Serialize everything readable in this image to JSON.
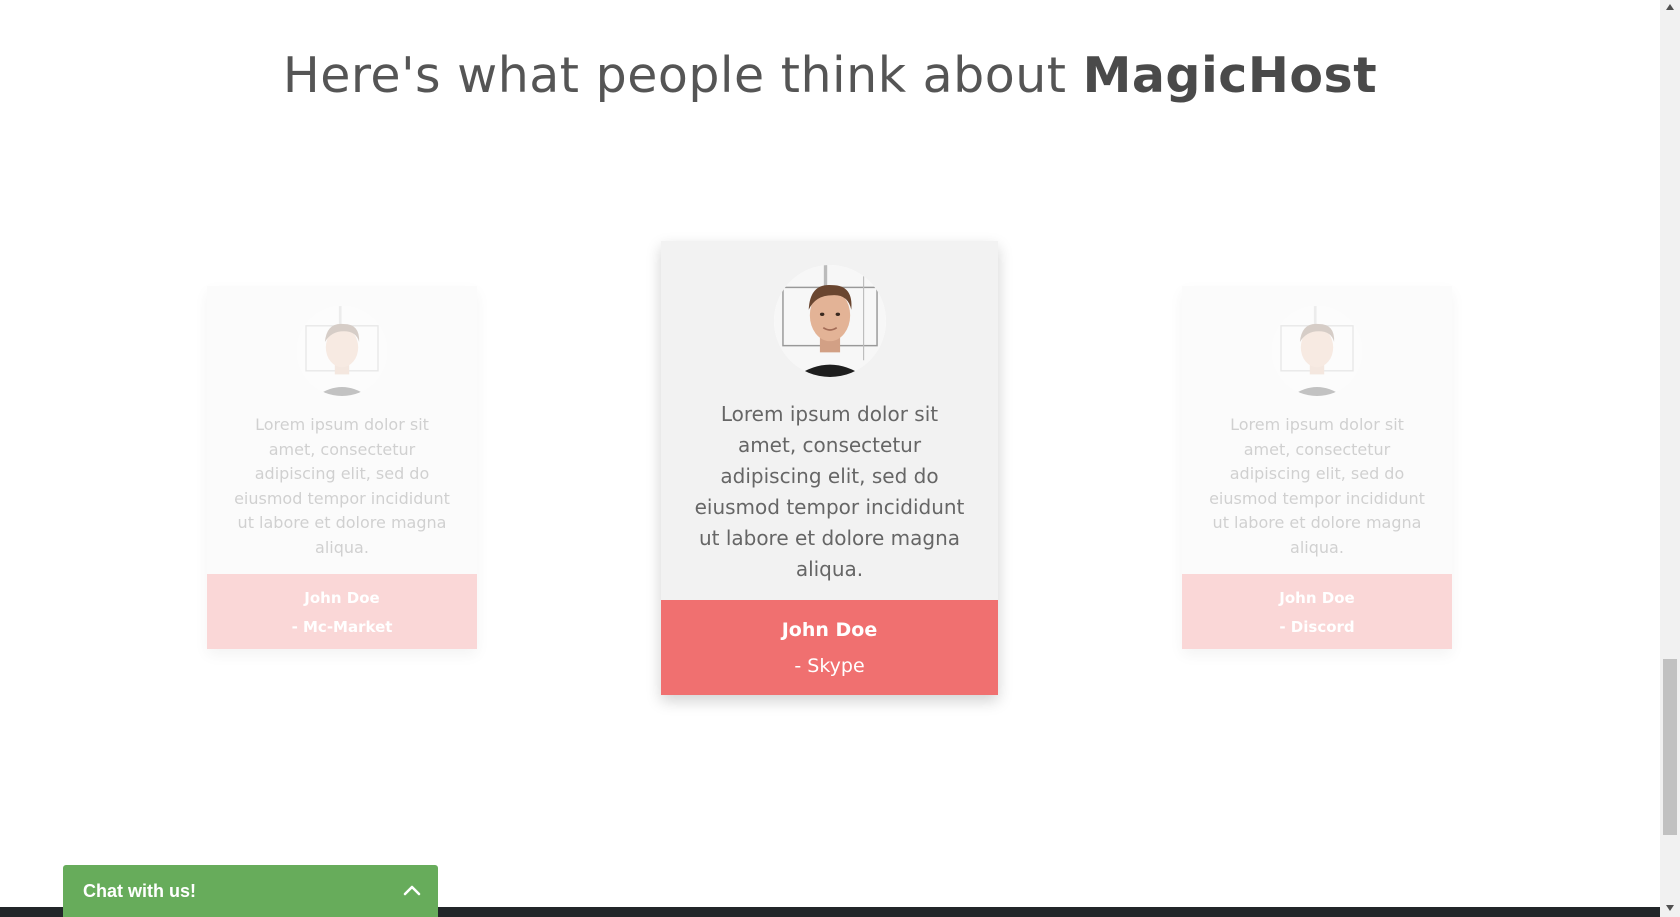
{
  "section": {
    "title_prefix": "Here's what people think about ",
    "title_brand": "MagicHost"
  },
  "testimonials": [
    {
      "quote": "Lorem ipsum dolor sit amet, consectetur adipiscing elit, sed do eiusmod tempor incididunt ut labore et dolore magna aliqua.",
      "name": "John Doe",
      "source": "- Mc-Market",
      "state": "faded"
    },
    {
      "quote": "Lorem ipsum dolor sit amet, consectetur adipiscing elit, sed do eiusmod tempor incididunt ut labore et dolore magna aliqua.",
      "name": "John Doe",
      "source": "- Skype",
      "state": "active"
    },
    {
      "quote": "Lorem ipsum dolor sit amet, consectetur adipiscing elit, sed do eiusmod tempor incididunt ut labore et dolore magna aliqua.",
      "name": "John Doe",
      "source": "- Discord",
      "state": "faded"
    }
  ],
  "chat": {
    "label": "Chat with us!",
    "icon": "chevron-up-icon"
  },
  "scrollbar": {
    "up_icon": "scroll-up-arrow-icon",
    "down_icon": "scroll-down-arrow-icon"
  },
  "colors": {
    "accent": "#f07070",
    "card_bg": "#f2f2f2",
    "chat_green": "#67ac5b",
    "footer_dark": "#222629",
    "text": "#555555"
  }
}
